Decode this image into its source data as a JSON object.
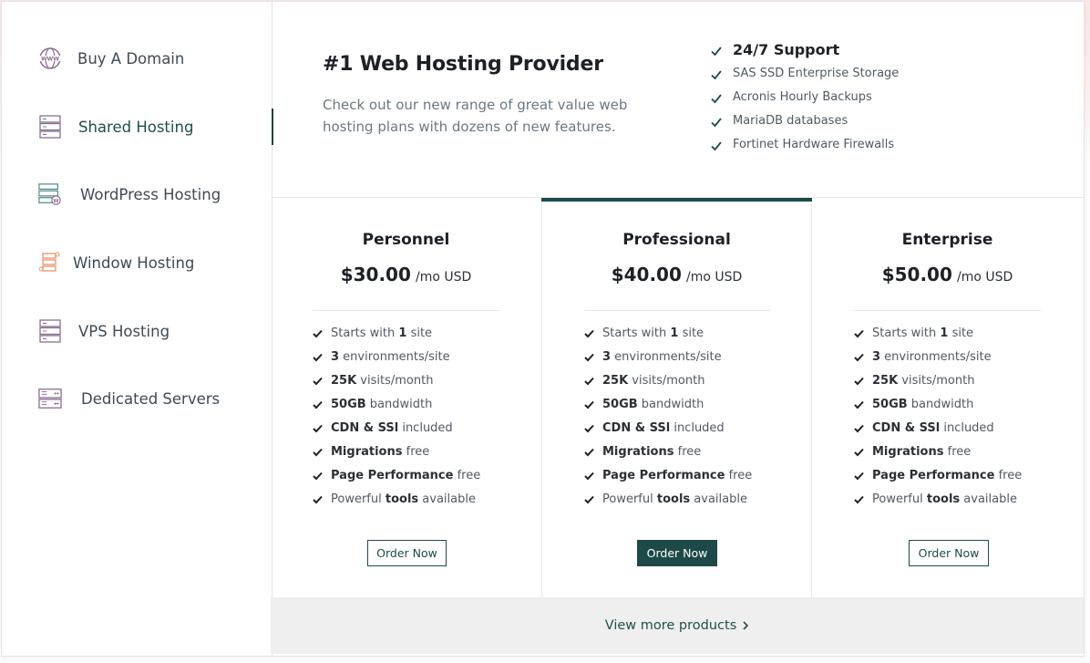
{
  "sidebar": {
    "items": [
      {
        "label": "Buy A Domain",
        "icon": "globe-www-icon"
      },
      {
        "label": "Shared Hosting",
        "icon": "server-icon",
        "active": true
      },
      {
        "label": "WordPress Hosting",
        "icon": "wordpress-server-icon"
      },
      {
        "label": "Window Hosting",
        "icon": "network-server-icon"
      },
      {
        "label": "VPS Hosting",
        "icon": "vps-server-icon"
      },
      {
        "label": "Dedicated Servers",
        "icon": "dedicated-server-icon"
      }
    ]
  },
  "hero": {
    "title": "#1 Web Hosting Provider",
    "subtitle": "Check out our new range of great value web hosting plans with dozens of new features."
  },
  "features": [
    "24/7 Support",
    "SAS SSD Enterprise Storage",
    "Acronis Hourly Backups",
    "MariaDB databases",
    "Fortinet Hardware Firewalls"
  ],
  "plans": [
    {
      "name": "Personnel",
      "price": "$30.00",
      "period": "/mo USD",
      "button": "Order Now",
      "highlighted": false
    },
    {
      "name": "Professional",
      "price": "$40.00",
      "period": "/mo USD",
      "button": "Order Now",
      "highlighted": true
    },
    {
      "name": "Enterprise",
      "price": "$50.00",
      "period": "/mo USD",
      "button": "Order Now",
      "highlighted": false
    }
  ],
  "plan_features": [
    {
      "pre": "Starts with ",
      "bold": "1",
      "post": " site"
    },
    {
      "pre": "",
      "bold": "3",
      "post": " environments/site"
    },
    {
      "pre": "",
      "bold": "25K",
      "post": " visits/month"
    },
    {
      "pre": "",
      "bold": "50GB",
      "post": " bandwidth"
    },
    {
      "pre": "",
      "bold": "CDN & SSl",
      "post": " included"
    },
    {
      "pre": "",
      "bold": "Migrations",
      "post": " free"
    },
    {
      "pre": "",
      "bold": "Page Performance",
      "post": " free"
    },
    {
      "pre": "Powerful ",
      "bold": "tools",
      "post": " available"
    }
  ],
  "footer": {
    "link": "View more products"
  },
  "colors": {
    "accent": "#1d4a49",
    "icon_purple": "#8a6d91",
    "icon_teal": "#4f8a86",
    "icon_orange": "#e8926b"
  }
}
